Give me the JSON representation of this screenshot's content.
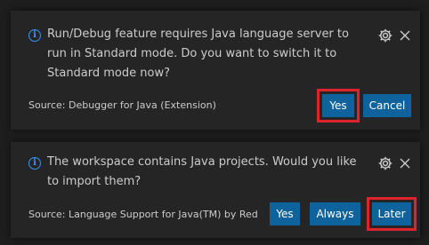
{
  "notifications": [
    {
      "message": "Run/Debug feature requires Java language server to run in Standard mode. Do you want to switch it to Standard mode now?",
      "source": "Source: Debugger for Java (Extension)",
      "buttons": [
        "Yes",
        "Cancel"
      ],
      "icons": {
        "info": "info-icon",
        "settings": "gear-icon",
        "close": "close-icon"
      }
    },
    {
      "message": "The workspace contains Java projects. Would you like to import them?",
      "source": "Source: Language Support for Java(TM) by Red ...",
      "buttons": [
        "Yes",
        "Always",
        "Later"
      ],
      "icons": {
        "info": "info-icon",
        "settings": "gear-icon",
        "close": "close-icon"
      }
    }
  ],
  "colors": {
    "background": "#1e1e1e",
    "toast_background": "#252526",
    "text": "#cccccc",
    "info_icon": "#3794ff",
    "button_background": "#0e639c",
    "button_text": "#ffffff",
    "highlight_outline": "#e0222d"
  }
}
